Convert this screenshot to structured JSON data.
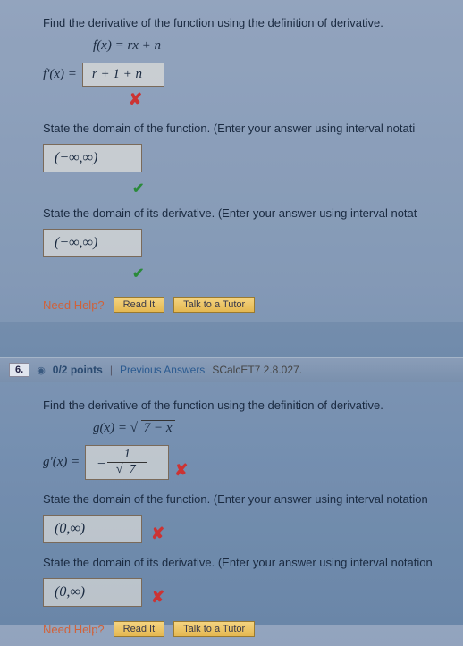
{
  "q5": {
    "prompt": "Find the derivative of the function using the definition of derivative.",
    "function": "f(x) = rx + n",
    "ans1_label": "f'(x) =",
    "ans1_value": "r + 1 + n",
    "ans1_mark": "✘",
    "sub1": "State the domain of the function. (Enter your answer using interval notati",
    "ans2_value": "(−∞,∞)",
    "ans2_mark": "✔",
    "sub2": "State the domain of its derivative. (Enter your answer using interval notat",
    "ans3_value": "(−∞,∞)",
    "ans3_mark": "✔",
    "need_help": "Need Help?",
    "read_it": "Read It",
    "talk": "Talk to a Tutor"
  },
  "q6": {
    "num": "6.",
    "points": "0/2 points",
    "prev": "Previous Answers",
    "ref": "SCalcET7 2.8.027.",
    "prompt": "Find the derivative of the function using the definition of derivative.",
    "function_lhs": "g(x) = ",
    "function_rad": "7 − x",
    "ans1_label": "g'(x) =",
    "ans1_sign": "−",
    "ans1_top": "1",
    "ans1_bot_rad": "7",
    "ans1_mark": "✘",
    "sub1": "State the domain of the function. (Enter your answer using interval notation",
    "ans2_value": "(0,∞)",
    "ans2_mark": "✘",
    "sub2": "State the domain of its derivative. (Enter your answer using interval notation",
    "ans3_value": "(0,∞)",
    "ans3_mark": "✘",
    "need_help": "Need Help?",
    "read_it": "Read It",
    "talk": "Talk to a Tutor"
  }
}
